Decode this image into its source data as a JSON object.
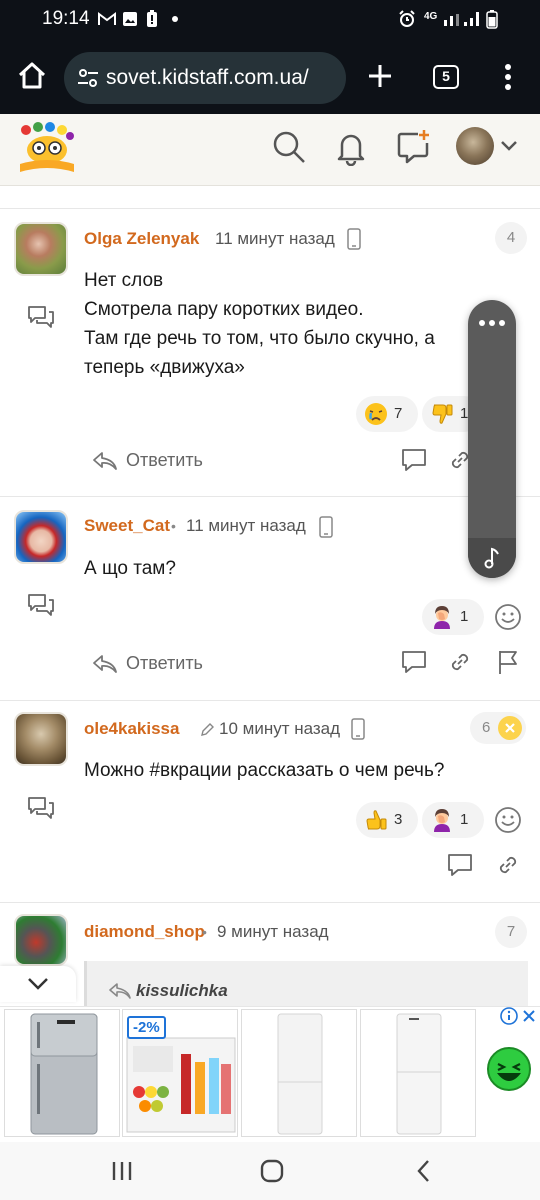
{
  "status_bar": {
    "time": "19:14",
    "left_icons": [
      "gmail-icon",
      "gallery-icon",
      "battery-saver-icon",
      "dot"
    ],
    "network_label": "4G",
    "right_icons": [
      "alarm-icon",
      "signal-icon",
      "battery-icon"
    ]
  },
  "browser": {
    "url": "sovet.kidstaff.com.ua/",
    "tab_count": "5",
    "icons": [
      "home-icon",
      "site-settings-icon",
      "new-tab-plus-icon",
      "tabs-icon",
      "menu-dots-icon"
    ]
  },
  "site_header": {
    "icons": [
      "logo",
      "search-icon",
      "bell-icon",
      "new-post-icon",
      "avatar",
      "chevron-down-icon"
    ]
  },
  "comments": [
    {
      "author": "Olga Zelenyak",
      "time": "11 минут назад",
      "number": "4",
      "lines": [
        "Нет слов",
        "Смотрела пару коротких видео.",
        "Там где речь то том, что было скучно, а",
        "теперь «движуха»"
      ],
      "reactions": [
        {
          "emoji": "crying-face",
          "count": "7"
        },
        {
          "emoji": "thumbs-down",
          "count": "1"
        }
      ],
      "reply_label": "Ответить"
    },
    {
      "author": "Sweet_Cat",
      "time": "11 минут назад",
      "number": "",
      "lines": [
        "А що там?"
      ],
      "reactions": [
        {
          "emoji": "facepalm",
          "count": "1"
        }
      ],
      "reply_label": "Ответить"
    },
    {
      "author": "ole4kakissa",
      "time": "10 минут назад",
      "number": "6",
      "edited": true,
      "lines": [
        "Можно #вкрации рассказать о чем речь?"
      ],
      "reactions": [
        {
          "emoji": "thumbs-up",
          "count": "3"
        },
        {
          "emoji": "facepalm",
          "count": "1"
        }
      ]
    },
    {
      "author": "diamond_shop",
      "time": "9 минут назад",
      "number": "7",
      "quote_author": "kissulichka"
    }
  ],
  "ad": {
    "discount_badge": "-2%",
    "products": [
      "fridge-steel",
      "mini-fridge",
      "fridge-white",
      "fridge-white-2"
    ]
  },
  "nav_bar": {
    "icons": [
      "recent-apps-icon",
      "home-circle-icon",
      "back-icon"
    ]
  },
  "colors": {
    "author": "#d2691e",
    "browser_bar": "#0d1117",
    "url_pill": "#263238",
    "header_bg": "#f7f6f2",
    "accent_blue": "#1e73d8"
  }
}
